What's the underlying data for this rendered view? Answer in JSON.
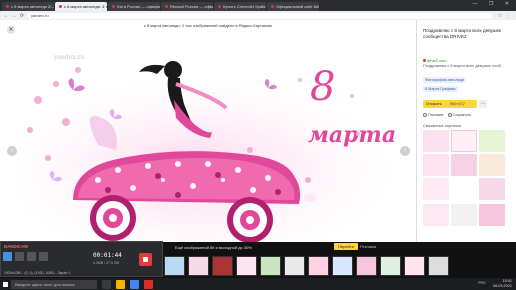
{
  "browser": {
    "tabs": [
      {
        "label": "с 8 марта автоледи 2 — Я",
        "active": false
      },
      {
        "label": "с 8 марта автоледи: 2 т",
        "active": true
      },
      {
        "label": "Kia в России — официаль",
        "active": false
      },
      {
        "label": "Renault Россия — официа",
        "active": false
      },
      {
        "label": "Купить Chevrolet Spark с",
        "active": false
      },
      {
        "label": "Официальный сайт LADA",
        "active": false
      }
    ],
    "url": "yandex.ru",
    "page_title": "с 8 марта автоледи: 2 тыс изображений найдено в Яндекс.Картинках",
    "window_controls": "— ❐ ✕"
  },
  "viewer": {
    "watermark": "yandex.ru",
    "prev_arrow": "‹",
    "next_arrow": "›",
    "close_symbol": "✕",
    "artwork": {
      "numeral": "8",
      "word": "марта"
    }
  },
  "panel": {
    "title": "Поздравляю с 8 марта всех девушек сообщества DRIVE2",
    "site": "drive2.com",
    "desc": "Поздравляю с 8 марта всех девушек сооб...",
    "tags": [
      "Фотография автоледи",
      "8 Марта Графика"
    ],
    "open_label": "Открыть",
    "size_label": "960×572",
    "actions": [
      "Похожие",
      "Сохранить"
    ],
    "similar_label": "Связанные картинки"
  },
  "strip": {
    "left_text": "Ещё 2 тыс. изображений ...",
    "mid_text": "Ещё изображений 8К и выходной до 30%",
    "btn_primary": "Перейти",
    "btn_secondary": "Реклама"
  },
  "bandicam": {
    "logo": "BANDICAM",
    "time": "00:01:44",
    "size": "4,3MB / 27,9 GB",
    "status": "1920x1080 - (0, 0), (1920, 1080) - Экран 1"
  },
  "taskbar": {
    "search_placeholder": "Введите здесь текст для поиска",
    "lang": "РУС",
    "time": "15:01",
    "date": "06.03.2021"
  },
  "colors": {
    "accent": "#fcd539",
    "brand_red": "#e3362e",
    "pink": "#e0489a",
    "magenta": "#b0206e"
  }
}
